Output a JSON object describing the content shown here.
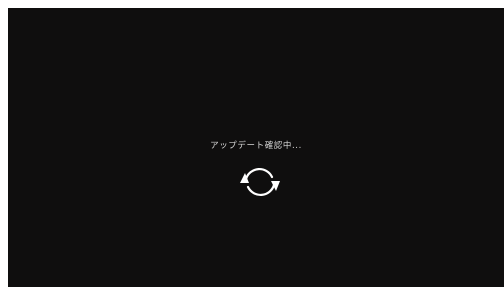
{
  "screen": {
    "status_text": "アップデート確認中...",
    "icon": "refresh-arrows-icon",
    "background_color": "#0f0e0e",
    "text_color": "#d8d8d8",
    "icon_color": "#ffffff"
  }
}
